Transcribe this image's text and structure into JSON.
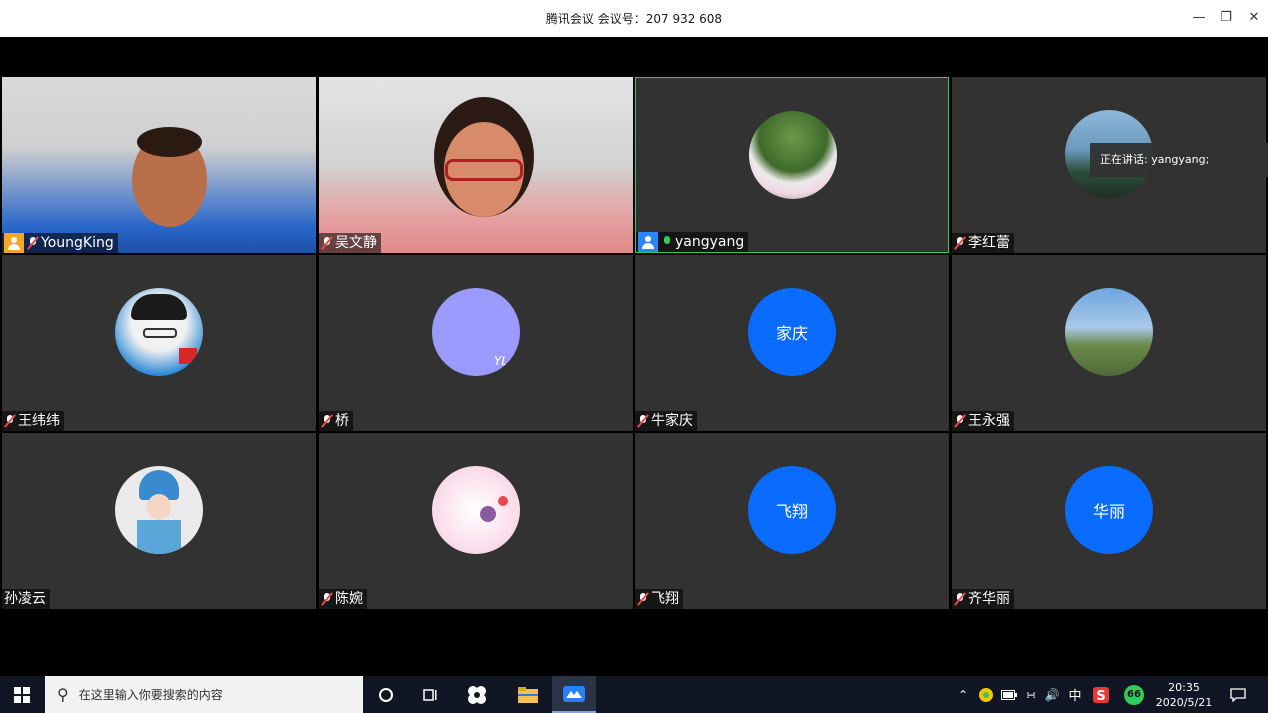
{
  "window": {
    "title": "腾讯会议 会议号：207 932 608",
    "minimize_icon": "minimize-icon",
    "restore_icon": "restore-icon",
    "close_icon": "close-icon"
  },
  "speaking_banner": "正在讲话: yangyang;",
  "participants": [
    {
      "name": "YoungKing",
      "mic": "muted",
      "host": true,
      "avatar": "camera-video"
    },
    {
      "name": "吴文静",
      "mic": "muted",
      "host": false,
      "avatar": "camera-video"
    },
    {
      "name": "yangyang",
      "mic": "on",
      "host": true,
      "avatar": "photo-flowers",
      "active": true
    },
    {
      "name": "李红蕾",
      "mic": "muted",
      "host": false,
      "avatar": "photo-landscape"
    },
    {
      "name": "王纬纬",
      "mic": "muted",
      "host": false,
      "avatar": "cartoon-panda-hat"
    },
    {
      "name": "桥",
      "mic": "muted",
      "host": false,
      "avatar": "lavender-circle",
      "avatar_text": "YL"
    },
    {
      "name": "牛家庆",
      "mic": "muted",
      "host": false,
      "avatar_text": "家庆"
    },
    {
      "name": "王永强",
      "mic": "muted",
      "host": false,
      "avatar": "photo-sky-field"
    },
    {
      "name": "孙凌云",
      "mic": "none",
      "host": false,
      "avatar": "opera-character"
    },
    {
      "name": "陈婉",
      "mic": "muted",
      "host": false,
      "avatar": "cartoon-bunny"
    },
    {
      "name": "飞翔",
      "mic": "muted",
      "host": false,
      "avatar_text": "飞翔"
    },
    {
      "name": "齐华丽",
      "mic": "muted",
      "host": false,
      "avatar_text": "华丽"
    }
  ],
  "taskbar": {
    "search_placeholder": "在这里输入你要搜索的内容",
    "ime": "中",
    "badge": "66",
    "time": "20:35",
    "date": "2020/5/21"
  },
  "colors": {
    "tile_bg": "#323232",
    "avatar_blue": "#0a6cff",
    "active_border": "#2ecc58",
    "taskbar_bg": "#101623"
  }
}
